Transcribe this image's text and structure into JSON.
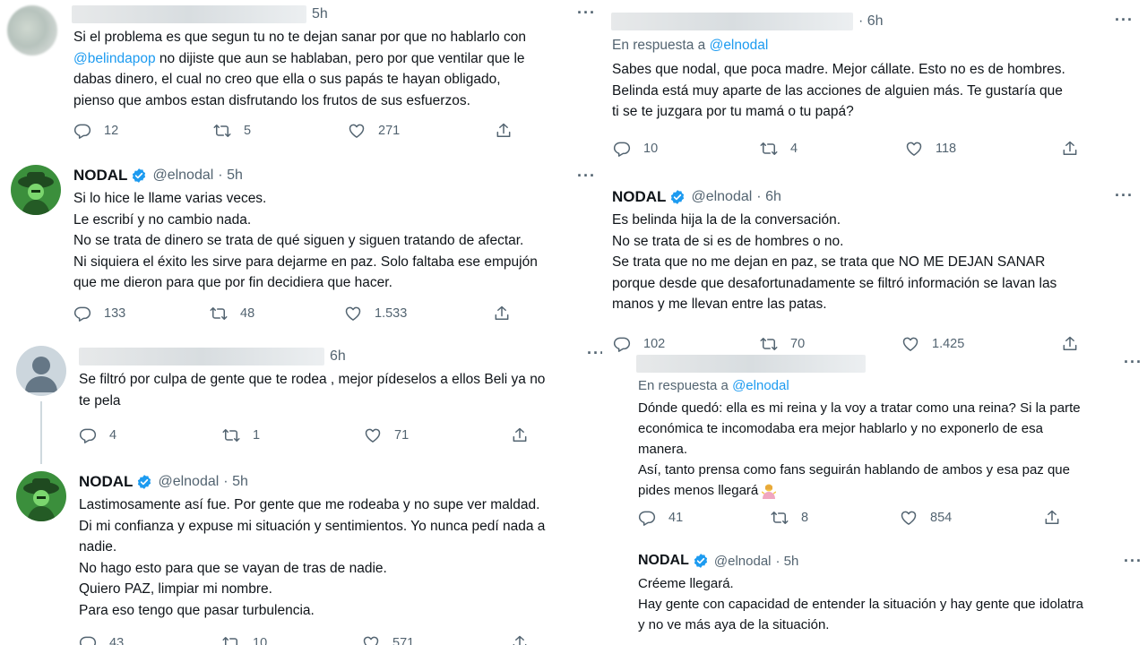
{
  "tweets": [
    {
      "time": "5h",
      "more": "···",
      "body_line_1": "Si el problema es que segun tu no te dejan sanar por que no hablarlo con",
      "body_line_2_mention": "@belindapop",
      "body_line_2_rest": " no dijiste que aun se hablaban, pero por que ventilar que le",
      "body_line_3": "dabas dinero, el cual no creo que ella o sus papás te hayan obligado,",
      "body_line_4": "pienso que ambos estan disfrutando los frutos de sus esfuerzos.",
      "replies": "12",
      "retweets": "5",
      "likes": "271"
    },
    {
      "name": "NODAL",
      "handle": "@elnodal",
      "time": "· 5h",
      "more": "···",
      "lines": [
        "Si lo hice le llame varias veces.",
        "Le escribí y no cambio nada.",
        "No se trata de dinero se trata de qué siguen y siguen tratando de afectar.",
        "Ni siquiera el éxito les sirve para dejarme en paz. Solo faltaba ese empujón",
        "que me dieron para que por fin decidiera que hacer."
      ],
      "replies": "133",
      "retweets": "48",
      "likes": "1.533"
    },
    {
      "time": "6h",
      "more": "···",
      "lines": [
        "Se filtró por culpa de gente que te rodea , mejor pídeselos a ellos Beli ya no",
        "te pela"
      ],
      "replies": "4",
      "retweets": "1",
      "likes": "71"
    },
    {
      "name": "NODAL",
      "handle": "@elnodal",
      "time": "· 5h",
      "lines": [
        "Lastimosamente así fue. Por gente que me rodeaba y no supe ver maldad.",
        "Di mi confianza y expuse mi situación y sentimientos. Yo nunca pedí nada a",
        "nadie.",
        "No hago esto para que se vayan de tras de nadie.",
        "Quiero PAZ, limpiar mi nombre.",
        "Para eso tengo que pasar turbulencia."
      ],
      "replies": "43",
      "retweets": "10",
      "likes": "571"
    },
    {
      "time": "· 6h",
      "more": "···",
      "reply_prefix": "En respuesta a",
      "reply_handle": "@elnodal",
      "lines": [
        "Sabes que nodal, que poca madre. Mejor cállate. Esto no es de hombres.",
        "Belinda está muy aparte de las acciones de alguien más. Te gustaría que",
        "ti se te juzgara por tu mamá o tu papá?"
      ],
      "replies": "10",
      "retweets": "4",
      "likes": "118"
    },
    {
      "name": "NODAL",
      "handle": "@elnodal",
      "time": "· 6h",
      "more": "···",
      "lines": [
        "Es belinda hija la de la conversación.",
        "No se trata de si es de hombres o no.",
        "Se trata que no me dejan en paz, se trata que NO ME DEJAN  SANAR",
        "porque desde que desafortunadamente se filtró información se lavan las",
        "manos y me llevan entre las patas."
      ],
      "replies": "102",
      "retweets": "70",
      "likes": "1.425"
    },
    {
      "more": "···",
      "reply_prefix": "En respuesta a",
      "reply_handle": "@elnodal",
      "lines": [
        "Dónde quedó: ella es mi reina y la voy a tratar como una reina? Si la parte",
        "económica te incomodaba era mejor hablarlo y no exponerlo de esa",
        "manera.",
        "Así, tanto prensa como fans seguirán hablando de ambos y esa paz que",
        "pides menos llegará"
      ],
      "replies": "41",
      "retweets": "8",
      "likes": "854"
    },
    {
      "name": "NODAL",
      "handle": "@elnodal",
      "time": "· 5h",
      "more": "···",
      "lines": [
        "Créeme llegará.",
        "Hay gente con capacidad de entender la situación y hay gente que idolatra",
        "y no ve más aya de la situación."
      ]
    }
  ],
  "icons": {
    "reply": "reply-icon",
    "retweet": "retweet-icon",
    "like": "heart-icon",
    "share": "share-icon",
    "verified": "verified-badge-icon",
    "emoji": "woman-shrugging-emoji"
  },
  "colors": {
    "link": "#1d9bf0",
    "text": "#0f1419",
    "muted": "#536471",
    "thread_line": "#cfd9de",
    "avatar_green": "#2c7a32"
  }
}
